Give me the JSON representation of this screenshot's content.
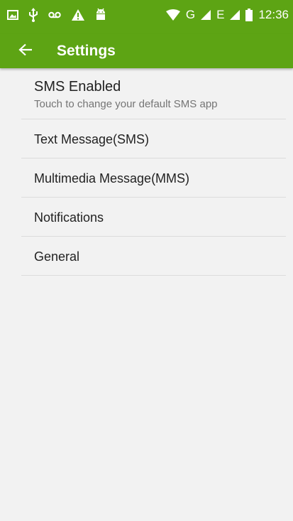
{
  "status_bar": {
    "time": "12:36",
    "network_labels": [
      "G",
      "E"
    ],
    "icons": [
      "image-notification-icon",
      "usb-icon",
      "voicemail-icon",
      "warning-icon",
      "android-debug-icon",
      "wifi-icon",
      "signal-g-icon",
      "signal-e-icon",
      "battery-icon"
    ],
    "background": "#5da414"
  },
  "app_bar": {
    "title": "Settings",
    "back_icon": "arrow-back-icon",
    "background": "#5da414"
  },
  "settings": {
    "items": [
      {
        "title": "SMS Enabled",
        "summary": "Touch to change your default SMS app"
      },
      {
        "title": "Text Message(SMS)"
      },
      {
        "title": "Multimedia Message(MMS)"
      },
      {
        "title": "Notifications"
      },
      {
        "title": "General"
      }
    ]
  },
  "colors": {
    "accent": "#5da414",
    "background": "#f2f2f2",
    "divider": "#dcdcdc",
    "primary_text": "#222222",
    "secondary_text": "#757575"
  }
}
